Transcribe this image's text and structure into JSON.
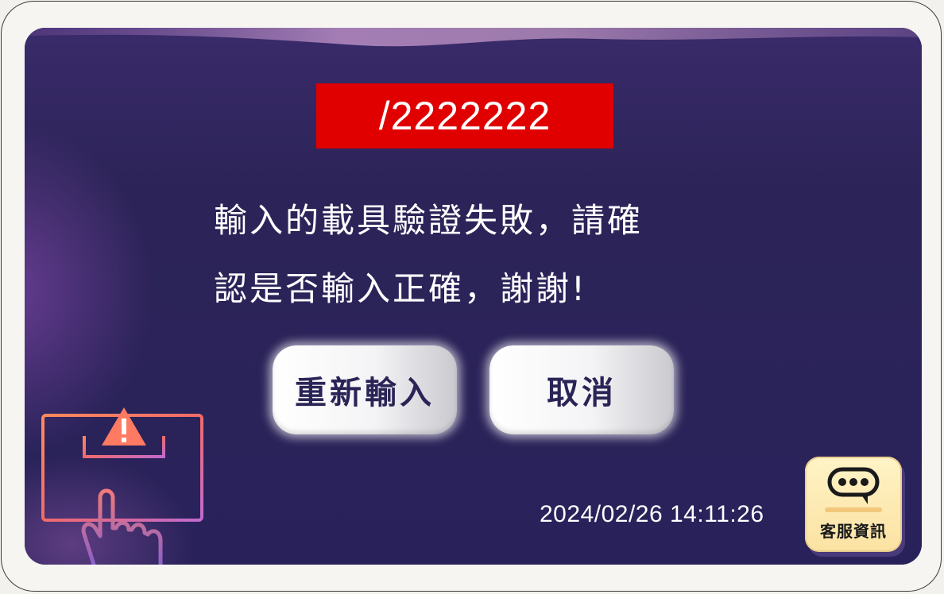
{
  "dialog": {
    "code": "/2222222",
    "message_line1": "輸入的載具驗證失敗，請確",
    "message_line2": "認是否輸入正確，謝謝!"
  },
  "buttons": {
    "reenter_label": "重新輸入",
    "cancel_label": "取消"
  },
  "status": {
    "timestamp": "2024/02/26 14:11:26"
  },
  "customer_service": {
    "label": "客服資訊",
    "icon": "chat-bubble-icon"
  },
  "illustration": {
    "icon": "warning-keyboard-touch-icon"
  },
  "colors": {
    "background": "#2a2254",
    "banner": "#e00000",
    "button_text": "#2a2456",
    "cs_button": "#fbe2a2"
  }
}
